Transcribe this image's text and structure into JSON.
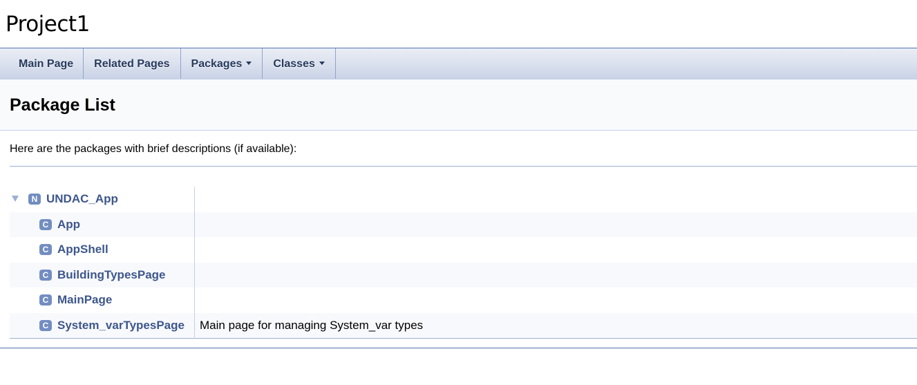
{
  "project": {
    "name": "Project1"
  },
  "nav": {
    "tabs": [
      {
        "label": "Main Page",
        "dropdown": false
      },
      {
        "label": "Related Pages",
        "dropdown": false
      },
      {
        "label": "Packages",
        "dropdown": true
      },
      {
        "label": "Classes",
        "dropdown": true
      }
    ]
  },
  "header": {
    "title": "Package List"
  },
  "contents": {
    "intro": "Here are the packages with brief descriptions (if available):",
    "tree": {
      "root": {
        "badge": "N",
        "name": "UNDAC_App",
        "expanded": true
      },
      "children": [
        {
          "badge": "C",
          "name": "App",
          "description": ""
        },
        {
          "badge": "C",
          "name": "AppShell",
          "description": ""
        },
        {
          "badge": "C",
          "name": "BuildingTypesPage",
          "description": ""
        },
        {
          "badge": "C",
          "name": "MainPage",
          "description": ""
        },
        {
          "badge": "C",
          "name": "System_varTypesPage",
          "description": "Main page for managing System_var types"
        }
      ]
    }
  },
  "colors": {
    "link": "#3D578C",
    "badge": "#728DC1",
    "nav_text": "#283A5D",
    "rule": "#9CAFD4"
  },
  "icons": {
    "expand": "triangle-down-icon",
    "namespace": "namespace-badge-icon",
    "class": "class-badge-icon"
  }
}
